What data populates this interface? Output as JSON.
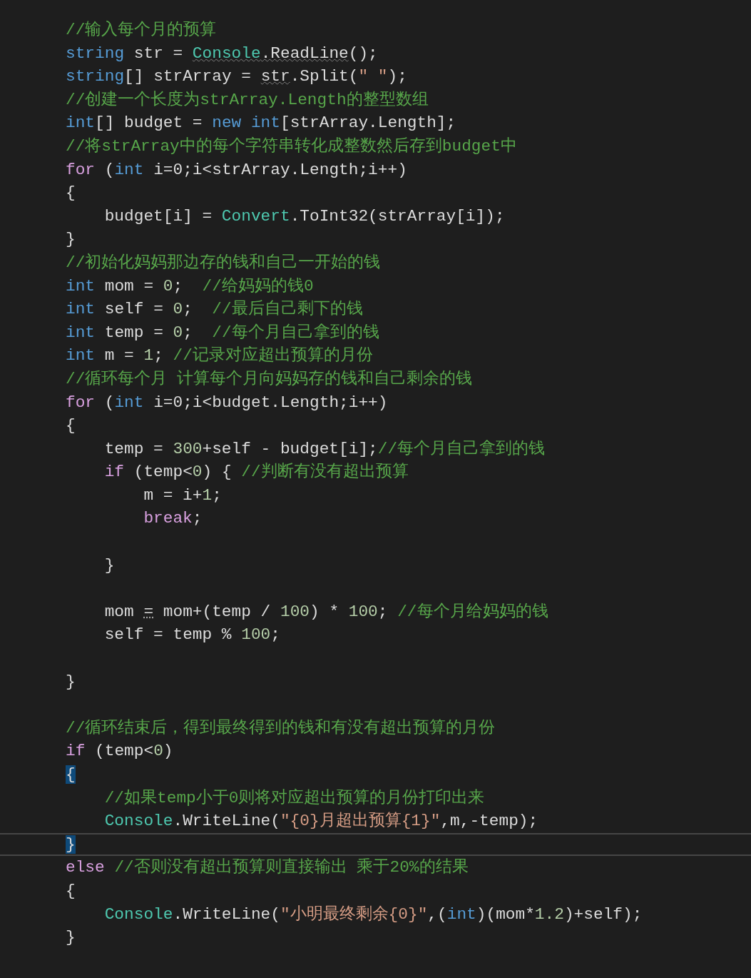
{
  "editor": {
    "lines": [
      {
        "tokens": [
          {
            "kind": "comment",
            "text": "//输入每个月的预算"
          }
        ]
      },
      {
        "tokens": [
          {
            "kind": "keyword",
            "text": "string"
          },
          {
            "kind": "plain",
            "text": " str = "
          },
          {
            "kind": "type",
            "text": "Console",
            "squiggle": true
          },
          {
            "kind": "plain",
            "text": ".ReadLine",
            "squiggle": true
          },
          {
            "kind": "plain",
            "text": "();"
          }
        ]
      },
      {
        "tokens": [
          {
            "kind": "keyword",
            "text": "string"
          },
          {
            "kind": "plain",
            "text": "[] strArray = "
          },
          {
            "kind": "plain",
            "text": "str",
            "squiggle": true
          },
          {
            "kind": "plain",
            "text": ".Split("
          },
          {
            "kind": "string",
            "text": "\" \""
          },
          {
            "kind": "plain",
            "text": ");"
          }
        ]
      },
      {
        "tokens": [
          {
            "kind": "comment",
            "text": "//创建一个长度为strArray.Length的整型数组"
          }
        ]
      },
      {
        "tokens": [
          {
            "kind": "keyword",
            "text": "int"
          },
          {
            "kind": "plain",
            "text": "[] budget = "
          },
          {
            "kind": "keyword",
            "text": "new int"
          },
          {
            "kind": "plain",
            "text": "[strArray.Length];"
          }
        ]
      },
      {
        "tokens": [
          {
            "kind": "comment",
            "text": "//将strArray中的每个字符串转化成整数然后存到budget中"
          }
        ]
      },
      {
        "tokens": [
          {
            "kind": "control",
            "text": "for"
          },
          {
            "kind": "plain",
            "text": " ("
          },
          {
            "kind": "keyword",
            "text": "int"
          },
          {
            "kind": "plain",
            "text": " i=0;i<strArray.Length;i++)"
          }
        ]
      },
      {
        "tokens": [
          {
            "kind": "plain",
            "text": "{"
          }
        ],
        "children": [
          {
            "tokens": [
              {
                "kind": "plain",
                "text": "budget[i] = "
              },
              {
                "kind": "type",
                "text": "Convert"
              },
              {
                "kind": "plain",
                "text": ".ToInt32(strArray[i]);"
              }
            ]
          }
        ]
      },
      {
        "tokens": [
          {
            "kind": "plain",
            "text": "}"
          }
        ]
      },
      {
        "tokens": [
          {
            "kind": "comment",
            "text": "//初始化妈妈那边存的钱和自己一开始的钱"
          }
        ]
      },
      {
        "tokens": [
          {
            "kind": "keyword",
            "text": "int"
          },
          {
            "kind": "plain",
            "text": " mom = "
          },
          {
            "kind": "number",
            "text": "0"
          },
          {
            "kind": "plain",
            "text": ";  "
          },
          {
            "kind": "comment",
            "text": "//给妈妈的钱0"
          }
        ]
      },
      {
        "tokens": [
          {
            "kind": "keyword",
            "text": "int"
          },
          {
            "kind": "plain",
            "text": " self = "
          },
          {
            "kind": "number",
            "text": "0"
          },
          {
            "kind": "plain",
            "text": ";  "
          },
          {
            "kind": "comment",
            "text": "//最后自己剩下的钱"
          }
        ]
      },
      {
        "tokens": [
          {
            "kind": "keyword",
            "text": "int"
          },
          {
            "kind": "plain",
            "text": " temp = "
          },
          {
            "kind": "number",
            "text": "0"
          },
          {
            "kind": "plain",
            "text": ";  "
          },
          {
            "kind": "comment",
            "text": "//每个月自己拿到的钱"
          }
        ]
      },
      {
        "tokens": [
          {
            "kind": "keyword",
            "text": "int"
          },
          {
            "kind": "plain",
            "text": " m = "
          },
          {
            "kind": "number",
            "text": "1"
          },
          {
            "kind": "plain",
            "text": "; "
          },
          {
            "kind": "comment",
            "text": "//记录对应超出预算的月份"
          }
        ]
      },
      {
        "tokens": [
          {
            "kind": "comment",
            "text": "//循环每个月 计算每个月向妈妈存的钱和自己剩余的钱"
          }
        ]
      },
      {
        "tokens": [
          {
            "kind": "control",
            "text": "for"
          },
          {
            "kind": "plain",
            "text": " ("
          },
          {
            "kind": "keyword",
            "text": "int"
          },
          {
            "kind": "plain",
            "text": " i=0;i<budget.Length;i++)"
          }
        ]
      },
      {
        "tokens": [
          {
            "kind": "plain",
            "text": "{"
          }
        ],
        "children": [
          {
            "tokens": [
              {
                "kind": "plain",
                "text": "temp = "
              },
              {
                "kind": "number",
                "text": "300"
              },
              {
                "kind": "plain",
                "text": "+self - budget[i];"
              },
              {
                "kind": "comment",
                "text": "//每个月自己拿到的钱"
              }
            ]
          },
          {
            "tokens": [
              {
                "kind": "control",
                "text": "if"
              },
              {
                "kind": "plain",
                "text": " (temp<"
              },
              {
                "kind": "number",
                "text": "0"
              },
              {
                "kind": "plain",
                "text": ") { "
              },
              {
                "kind": "comment",
                "text": "//判断有没有超出预算"
              }
            ],
            "children": [
              {
                "tokens": [
                  {
                    "kind": "plain",
                    "text": "m = i+"
                  },
                  {
                    "kind": "number",
                    "text": "1"
                  },
                  {
                    "kind": "plain",
                    "text": ";"
                  }
                ]
              },
              {
                "tokens": [
                  {
                    "kind": "control",
                    "text": "break"
                  },
                  {
                    "kind": "plain",
                    "text": ";"
                  }
                ]
              },
              {
                "kind": "blank"
              }
            ]
          },
          {
            "tokens": [
              {
                "kind": "plain",
                "text": "}"
              }
            ]
          },
          {
            "kind": "blank"
          },
          {
            "tokens": [
              {
                "kind": "plain",
                "text": "mom "
              },
              {
                "kind": "plain",
                "text": "=",
                "dotted": true
              },
              {
                "kind": "plain",
                "text": " mom+(temp / "
              },
              {
                "kind": "number",
                "text": "100"
              },
              {
                "kind": "plain",
                "text": ") * "
              },
              {
                "kind": "number",
                "text": "100"
              },
              {
                "kind": "plain",
                "text": "; "
              },
              {
                "kind": "comment",
                "text": "//每个月给妈妈的钱"
              }
            ]
          },
          {
            "tokens": [
              {
                "kind": "plain",
                "text": "self = temp % "
              },
              {
                "kind": "number",
                "text": "100"
              },
              {
                "kind": "plain",
                "text": ";"
              }
            ]
          },
          {
            "kind": "blank"
          }
        ]
      },
      {
        "tokens": [
          {
            "kind": "plain",
            "text": "}"
          }
        ]
      },
      {
        "kind": "blank"
      },
      {
        "tokens": [
          {
            "kind": "comment",
            "text": "//循环结束后，得到最终得到的钱和有没有超出预算的月份"
          }
        ]
      },
      {
        "tokens": [
          {
            "kind": "control",
            "text": "if"
          },
          {
            "kind": "plain",
            "text": " (temp<"
          },
          {
            "kind": "number",
            "text": "0"
          },
          {
            "kind": "plain",
            "text": ")"
          }
        ]
      },
      {
        "tokens": [
          {
            "kind": "plain",
            "text": "{",
            "match": true
          }
        ],
        "children": [
          {
            "tokens": [
              {
                "kind": "comment",
                "text": "//如果temp小于0则将对应超出预算的月份打印出来"
              }
            ]
          },
          {
            "tokens": [
              {
                "kind": "type",
                "text": "Console"
              },
              {
                "kind": "plain",
                "text": ".WriteLine("
              },
              {
                "kind": "string",
                "text": "\"{0}月超出预算{1}\""
              },
              {
                "kind": "plain",
                "text": ",m,-temp);"
              }
            ]
          }
        ]
      },
      {
        "current": true,
        "tokens": [
          {
            "kind": "plain",
            "text": "}",
            "match": true
          }
        ]
      },
      {
        "tokens": [
          {
            "kind": "control",
            "text": "else"
          },
          {
            "kind": "comment",
            "text": "//否则没有超出预算则直接输出 乘于20%的结果",
            "gap": true
          }
        ]
      },
      {
        "tokens": [
          {
            "kind": "plain",
            "text": "{"
          }
        ],
        "children": [
          {
            "tokens": [
              {
                "kind": "type",
                "text": "Console"
              },
              {
                "kind": "plain",
                "text": ".WriteLine("
              },
              {
                "kind": "string",
                "text": "\"小明最终剩余{0}\""
              },
              {
                "kind": "plain",
                "text": ",("
              },
              {
                "kind": "keyword",
                "text": "int"
              },
              {
                "kind": "plain",
                "text": ")(mom*"
              },
              {
                "kind": "number",
                "text": "1.2"
              },
              {
                "kind": "plain",
                "text": ")+self);"
              }
            ]
          }
        ]
      },
      {
        "tokens": [
          {
            "kind": "plain",
            "text": "}"
          }
        ]
      }
    ]
  }
}
